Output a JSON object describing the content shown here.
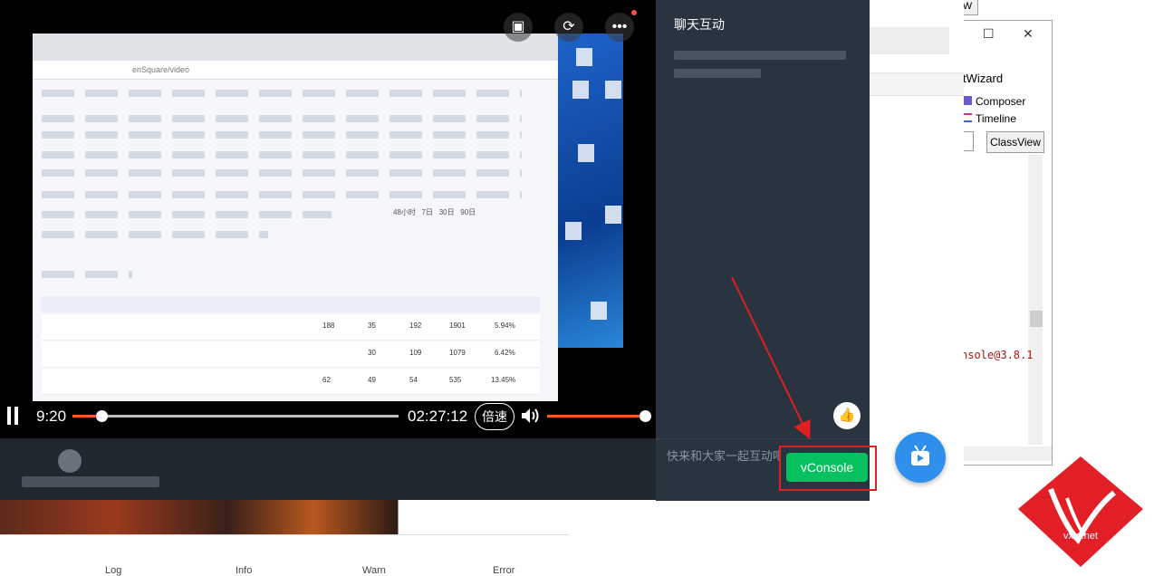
{
  "player": {
    "current_time": "9:20",
    "total_time": "02:27:12",
    "speed_label": "倍速",
    "progress_fraction": 0.09,
    "volume_fraction": 1.0,
    "screen_share_values": [
      "188",
      "35",
      "192",
      "1901",
      "5.94%",
      "30",
      "109",
      "1079",
      "6.42%",
      "62",
      "49",
      "54",
      "535",
      "13.45%"
    ],
    "screen_share_url": "enSquare/video",
    "screen_share_filter_labels": [
      "48小时",
      "7日",
      "30日",
      "90日"
    ]
  },
  "chat": {
    "title": "聊天互动",
    "input_placeholder": "快来和大家一起互动吧",
    "vconsole_label": "vConsole"
  },
  "ide": {
    "tab_fragment": "W",
    "wizard_label": "tWizard",
    "composer_label": "Composer",
    "timeline_label": "Timeline",
    "classview_label": "ClassView",
    "console_text": "nsole@3.8.1"
  },
  "console_tabs": [
    "Log",
    "Info",
    "Warn",
    "Error"
  ],
  "watermark": {
    "text": "vxia.net"
  },
  "colors": {
    "accent_orange": "#ff5722",
    "vconsole_green": "#07c160",
    "annotation_red": "#e02020",
    "fab_blue": "#2f8fec"
  }
}
